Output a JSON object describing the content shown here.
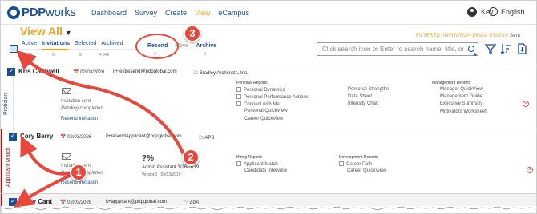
{
  "nav": {
    "logo_bold": "PDP",
    "logo_light": "works",
    "links": [
      "Dashboard",
      "Survey",
      "Create",
      "View",
      "eCampus"
    ],
    "active": "View",
    "user": "Key",
    "language": "English"
  },
  "header": {
    "title": "View All",
    "filter_label": "FILTERED: INVITATION EMAIL STATUS",
    "filter_value": "Sent",
    "tabs": [
      "Active",
      "Invitations",
      "Selected",
      "Archived"
    ],
    "tab_counts": [
      "600",
      "3",
      "3",
      "4,048"
    ],
    "actions": [
      "Resend",
      "Move",
      "Archive"
    ],
    "action_counts": [
      "3",
      "",
      "3"
    ],
    "search_placeholder": "Click search icon or Enter to search name, title, or ..."
  },
  "rows": [
    {
      "side": "Profician",
      "name": "Kris Cantwell",
      "date": "02/03/2026",
      "email": "it+testresend@pdpglobal.com",
      "org": "Bradley Architects, Inc.",
      "status1": "Invitation sent",
      "status2": "Pending completion",
      "link": "Resend Invitation",
      "personal_head": "Personal Reports",
      "personal": [
        "Personal Dynamics",
        "Personal Performance Actions",
        "Connect with Me",
        "Personal QuickView",
        "Career QuickView"
      ],
      "strengths": [
        "Personal Strengths",
        "Data Sheet",
        "Intensity Chart"
      ],
      "mgmt_head": "Management Reports",
      "mgmt": [
        "Manager QuickView",
        "Management Guide",
        "Executive Summary",
        "Motivators Worksheet"
      ]
    },
    {
      "side": "Applicant Match",
      "name": "Cory Berry",
      "date": "02/03/2026",
      "email": "it+resendApplicant@pdpglobal.com",
      "org": "APS",
      "status1": "Invitation sent",
      "status2": "Pending completion",
      "link": "Resend Invitation",
      "score": "?%",
      "job": "Admin Assistant 3/26/2019",
      "version": "Version1 | 06/13/2019",
      "hiring_head": "Hiring Reports",
      "hiring": [
        "Applicant Match",
        "Candidate Interview"
      ],
      "dev_head": "Development Reports",
      "dev": [
        "Career Path",
        "Career QuickView"
      ]
    },
    {
      "name": "Appy Cant",
      "date": "02/03/2026",
      "email": "it+appycant@pdpglobal.com",
      "org": "APS"
    }
  ],
  "annotations": [
    "1",
    "2",
    "3"
  ],
  "colors": {
    "brand": "#1b4f91",
    "accent": "#f0a023",
    "annotation": "#e8483c"
  }
}
